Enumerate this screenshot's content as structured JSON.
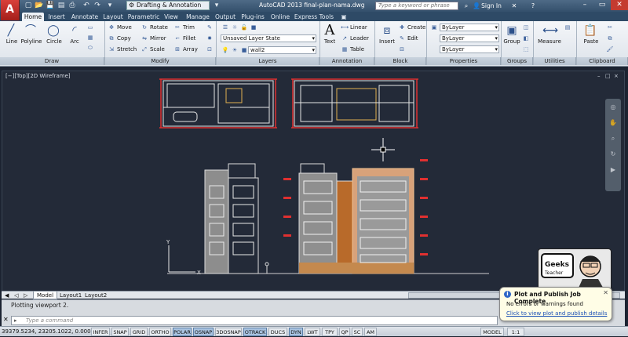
{
  "title": {
    "logo": "A",
    "workspace": "Drafting & Annotation",
    "app_title": "AutoCAD 2013   final-plan-nama.dwg",
    "search_placeholder": "Type a keyword or phrase",
    "sign_in": "Sign In"
  },
  "tabs": [
    "Home",
    "Insert",
    "Annotate",
    "Layout",
    "Parametric",
    "View",
    "Manage",
    "Output",
    "Plug-ins",
    "Online",
    "Express Tools"
  ],
  "panels": {
    "draw": {
      "title": "Draw",
      "line": "Line",
      "polyline": "Polyline",
      "circle": "Circle",
      "arc": "Arc"
    },
    "modify": {
      "title": "Modify",
      "move": "Move",
      "rotate": "Rotate",
      "trim": "Trim",
      "copy": "Copy",
      "mirror": "Mirror",
      "fillet": "Fillet",
      "stretch": "Stretch",
      "scale": "Scale",
      "array": "Array"
    },
    "layers": {
      "title": "Layers",
      "layer_state": "Unsaved Layer State",
      "current_layer": "wall2"
    },
    "annotation": {
      "title": "Annotation",
      "text": "Text",
      "linear": "Linear",
      "leader": "Leader",
      "table": "Table"
    },
    "block": {
      "title": "Block",
      "insert": "Insert",
      "create": "Create",
      "edit": "Edit"
    },
    "properties": {
      "title": "Properties",
      "color": "ByLayer",
      "linetype": "ByLayer",
      "lineweight": "ByLayer"
    },
    "groups": {
      "title": "Groups",
      "group": "Group"
    },
    "utilities": {
      "title": "Utilities",
      "measure": "Measure"
    },
    "clipboard": {
      "title": "Clipboard",
      "paste": "Paste"
    }
  },
  "viewport": {
    "label": "[−][Top][2D Wireframe]",
    "min": "–",
    "restore": "□",
    "close": "×"
  },
  "layout_tabs": [
    "Model",
    "Layout1",
    "Layout2"
  ],
  "command": {
    "history": "Plotting viewport 2.",
    "placeholder": "Type a command"
  },
  "status": {
    "coords": "39379.5234, 23205.1022, 0.0000",
    "toggles": [
      {
        "label": "INFER",
        "on": false
      },
      {
        "label": "SNAP",
        "on": false
      },
      {
        "label": "GRID",
        "on": false
      },
      {
        "label": "ORTHO",
        "on": false
      },
      {
        "label": "POLAR",
        "on": true
      },
      {
        "label": "OSNAP",
        "on": true
      },
      {
        "label": "3DOSNAP",
        "on": false
      },
      {
        "label": "OTRACK",
        "on": true
      },
      {
        "label": "DUCS",
        "on": false
      },
      {
        "label": "DYN",
        "on": true
      },
      {
        "label": "LWT",
        "on": false
      },
      {
        "label": "TPY",
        "on": false
      },
      {
        "label": "QP",
        "on": false
      },
      {
        "label": "SC",
        "on": false
      },
      {
        "label": "AM",
        "on": false
      }
    ],
    "model": "MODEL",
    "scale": "1:1"
  },
  "balloon": {
    "title": "Plot and Publish Job Complete",
    "line": "No errors or warnings found",
    "link": "Click to view plot and publish details"
  },
  "watermark": "Geeks Teacher"
}
